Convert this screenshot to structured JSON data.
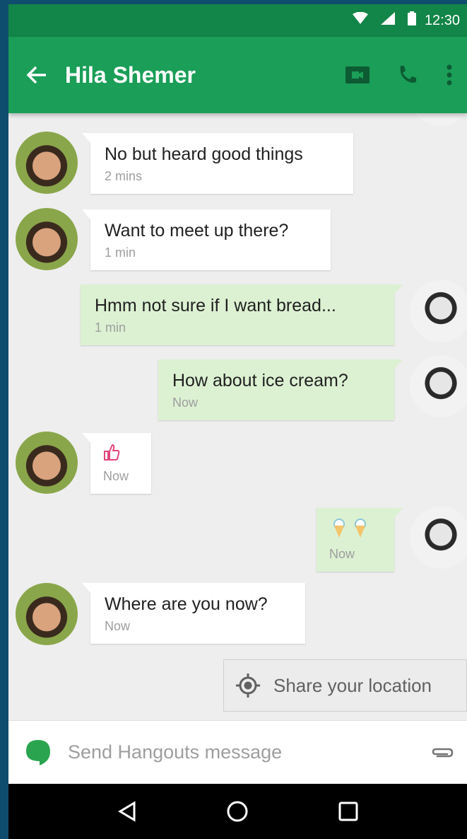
{
  "status_bar": {
    "time": "12:30"
  },
  "app_bar": {
    "title": "Hila Shemer"
  },
  "messages": [
    {
      "sender": "contact",
      "text": "No but heard good things",
      "time": "2 mins"
    },
    {
      "sender": "contact",
      "text": "Want to meet up there?",
      "time": "1 min"
    },
    {
      "sender": "me",
      "text": "Hmm not sure if I want bread...",
      "time": "1 min"
    },
    {
      "sender": "me",
      "text": "How about ice cream?",
      "time": "Now"
    },
    {
      "sender": "contact",
      "emoji": "thumbs-up",
      "time": "Now"
    },
    {
      "sender": "me",
      "emoji": "ice-cream-cones",
      "time": "Now"
    },
    {
      "sender": "contact",
      "text": "Where are you now?",
      "time": "Now"
    }
  ],
  "share_location": {
    "label": "Share your location"
  },
  "composer": {
    "placeholder": "Send Hangouts message"
  },
  "colors": {
    "header": "#1a9e58",
    "status": "#128548",
    "outgoing_bubble": "#dcf1d2",
    "incoming_bubble": "#ffffff"
  },
  "icons": [
    "wifi-icon",
    "signal-icon",
    "battery-icon",
    "back-arrow-icon",
    "video-call-icon",
    "phone-icon",
    "more-vert-icon",
    "location-icon",
    "hangouts-icon",
    "paperclip-icon",
    "nav-back-icon",
    "nav-home-icon",
    "nav-recents-icon"
  ]
}
